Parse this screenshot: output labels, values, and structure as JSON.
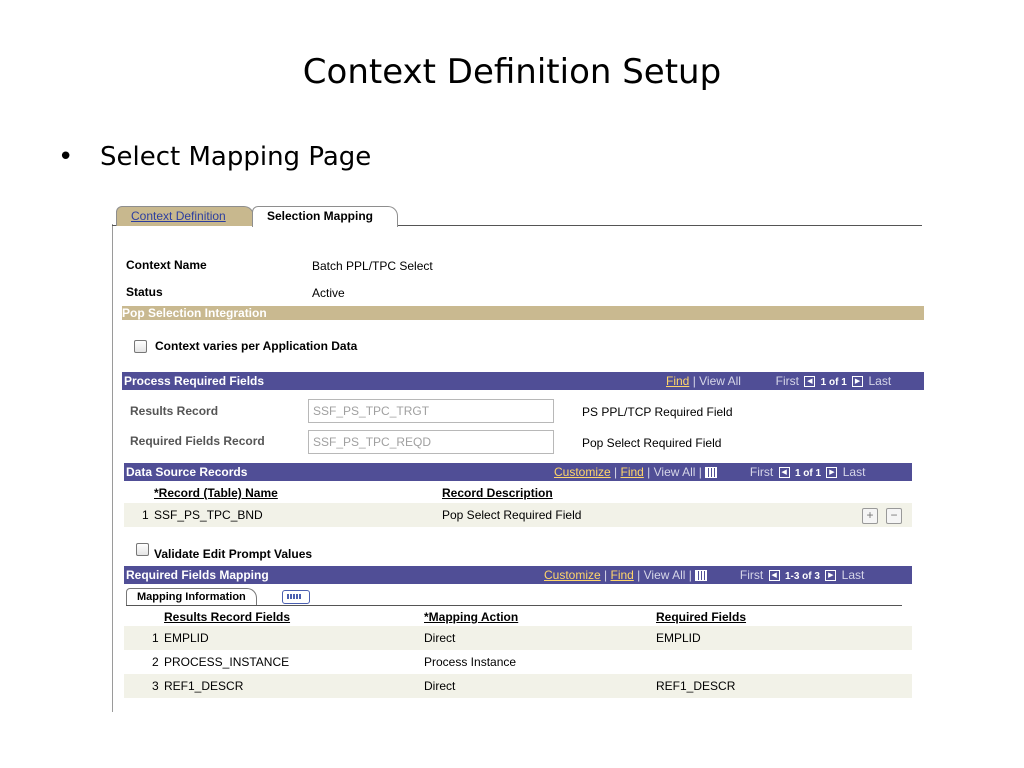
{
  "slide": {
    "title": "Context Definition Setup",
    "bullet": "Select Mapping Page"
  },
  "tabs": [
    {
      "label": "Context Definition",
      "active": false
    },
    {
      "label": "Selection Mapping",
      "active": true
    }
  ],
  "context": {
    "name_label": "Context Name",
    "name_value": "Batch PPL/TPC Select",
    "status_label": "Status",
    "status_value": "Active"
  },
  "pop_section": {
    "title": "Pop Selection Integration",
    "checkbox_label": "Context varies per Application Data",
    "checked": false
  },
  "process_required": {
    "title": "Process Required Fields",
    "find": "Find",
    "view_all": "View All",
    "first": "First",
    "count": "1 of 1",
    "last": "Last",
    "results_label": "Results Record",
    "results_value": "SSF_PS_TPC_TRGT",
    "results_desc": "PS PPL/TCP Required Field",
    "required_label": "Required Fields Record",
    "required_value": "SSF_PS_TPC_REQD",
    "required_desc": "Pop Select Required Field"
  },
  "data_source": {
    "title": "Data Source Records",
    "customize": "Customize",
    "find": "Find",
    "view_all": "View All",
    "first": "First",
    "count": "1 of 1",
    "last": "Last",
    "col_name": "*Record (Table) Name",
    "col_desc": "Record Description",
    "rows": [
      {
        "num": "1",
        "name": "SSF_PS_TPC_BND",
        "desc": "Pop Select Required Field"
      }
    ]
  },
  "validate": {
    "label": "Validate Edit Prompt Values",
    "checked": false
  },
  "mapping": {
    "title": "Required Fields Mapping",
    "customize": "Customize",
    "find": "Find",
    "view_all": "View All",
    "first": "First",
    "count": "1-3 of 3",
    "last": "Last",
    "subtab": "Mapping Information",
    "col_results": "Results Record Fields",
    "col_action": "*Mapping Action",
    "col_required": "Required Fields",
    "rows": [
      {
        "num": "1",
        "field": "EMPLID",
        "action": "Direct",
        "required": "EMPLID"
      },
      {
        "num": "2",
        "field": "PROCESS_INSTANCE",
        "action": "Process Instance",
        "required": ""
      },
      {
        "num": "3",
        "field": "REF1_DESCR",
        "action": "Direct",
        "required": "REF1_DESCR"
      }
    ]
  },
  "colors": {
    "grid_header": "#504e96",
    "gold_bar": "#c9b990",
    "link_gold": "#ffd66a",
    "tab_inactive": "#c8b88e"
  }
}
